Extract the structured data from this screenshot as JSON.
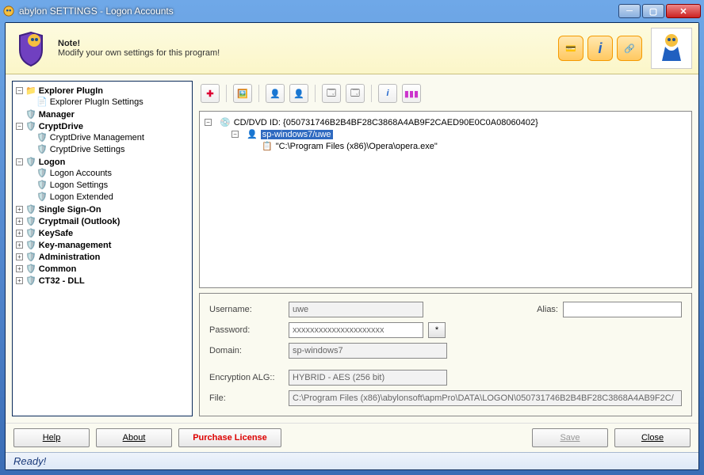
{
  "window": {
    "title": "abylon SETTINGS - Logon Accounts"
  },
  "note": {
    "heading": "Note!",
    "text": "Modify your own settings for this program!"
  },
  "header_icons": {
    "a": "card-icon",
    "b": "info-icon",
    "c": "link-icon"
  },
  "tree": {
    "n0": "Explorer PlugIn",
    "n0_0": "Explorer PlugIn Settings",
    "n1": "Manager",
    "n2": "CryptDrive",
    "n2_0": "CryptDrive Management",
    "n2_1": "CryptDrive Settings",
    "n3": "Logon",
    "n3_0": "Logon Accounts",
    "n3_1": "Logon Settings",
    "n3_2": "Logon Extended",
    "n4": "Single Sign-On",
    "n5": "Cryptmail (Outlook)",
    "n6": "KeySafe",
    "n7": "Key-management",
    "n8": "Administration",
    "n9": "Common",
    "n10": "CT32 - DLL"
  },
  "content_tree": {
    "root": "CD/DVD ID: {050731746B2B4BF28C3868A4AB9F2CAED90E0C0A08060402}",
    "user": "sp-windows7/uwe",
    "path": "\"C:\\Program Files (x86)\\Opera\\opera.exe\""
  },
  "form": {
    "labels": {
      "user": "Username:",
      "pass": "Password:",
      "domain": "Domain:",
      "alg": "Encryption ALG::",
      "file": "File:",
      "alias": "Alias:"
    },
    "values": {
      "user": "uwe",
      "pass": "xxxxxxxxxxxxxxxxxxxxx",
      "domain": "sp-windows7",
      "alg": "HYBRID - AES (256 bit)",
      "file": "C:\\Program Files (x86)\\abylonsoft\\apmPro\\DATA\\LOGON\\050731746B2B4BF28C3868A4AB9F2C/",
      "alias": ""
    }
  },
  "buttons": {
    "help": "Help",
    "about": "About",
    "purchase": "Purchase License",
    "save": "Save",
    "close": "Close"
  },
  "status": "Ready!"
}
